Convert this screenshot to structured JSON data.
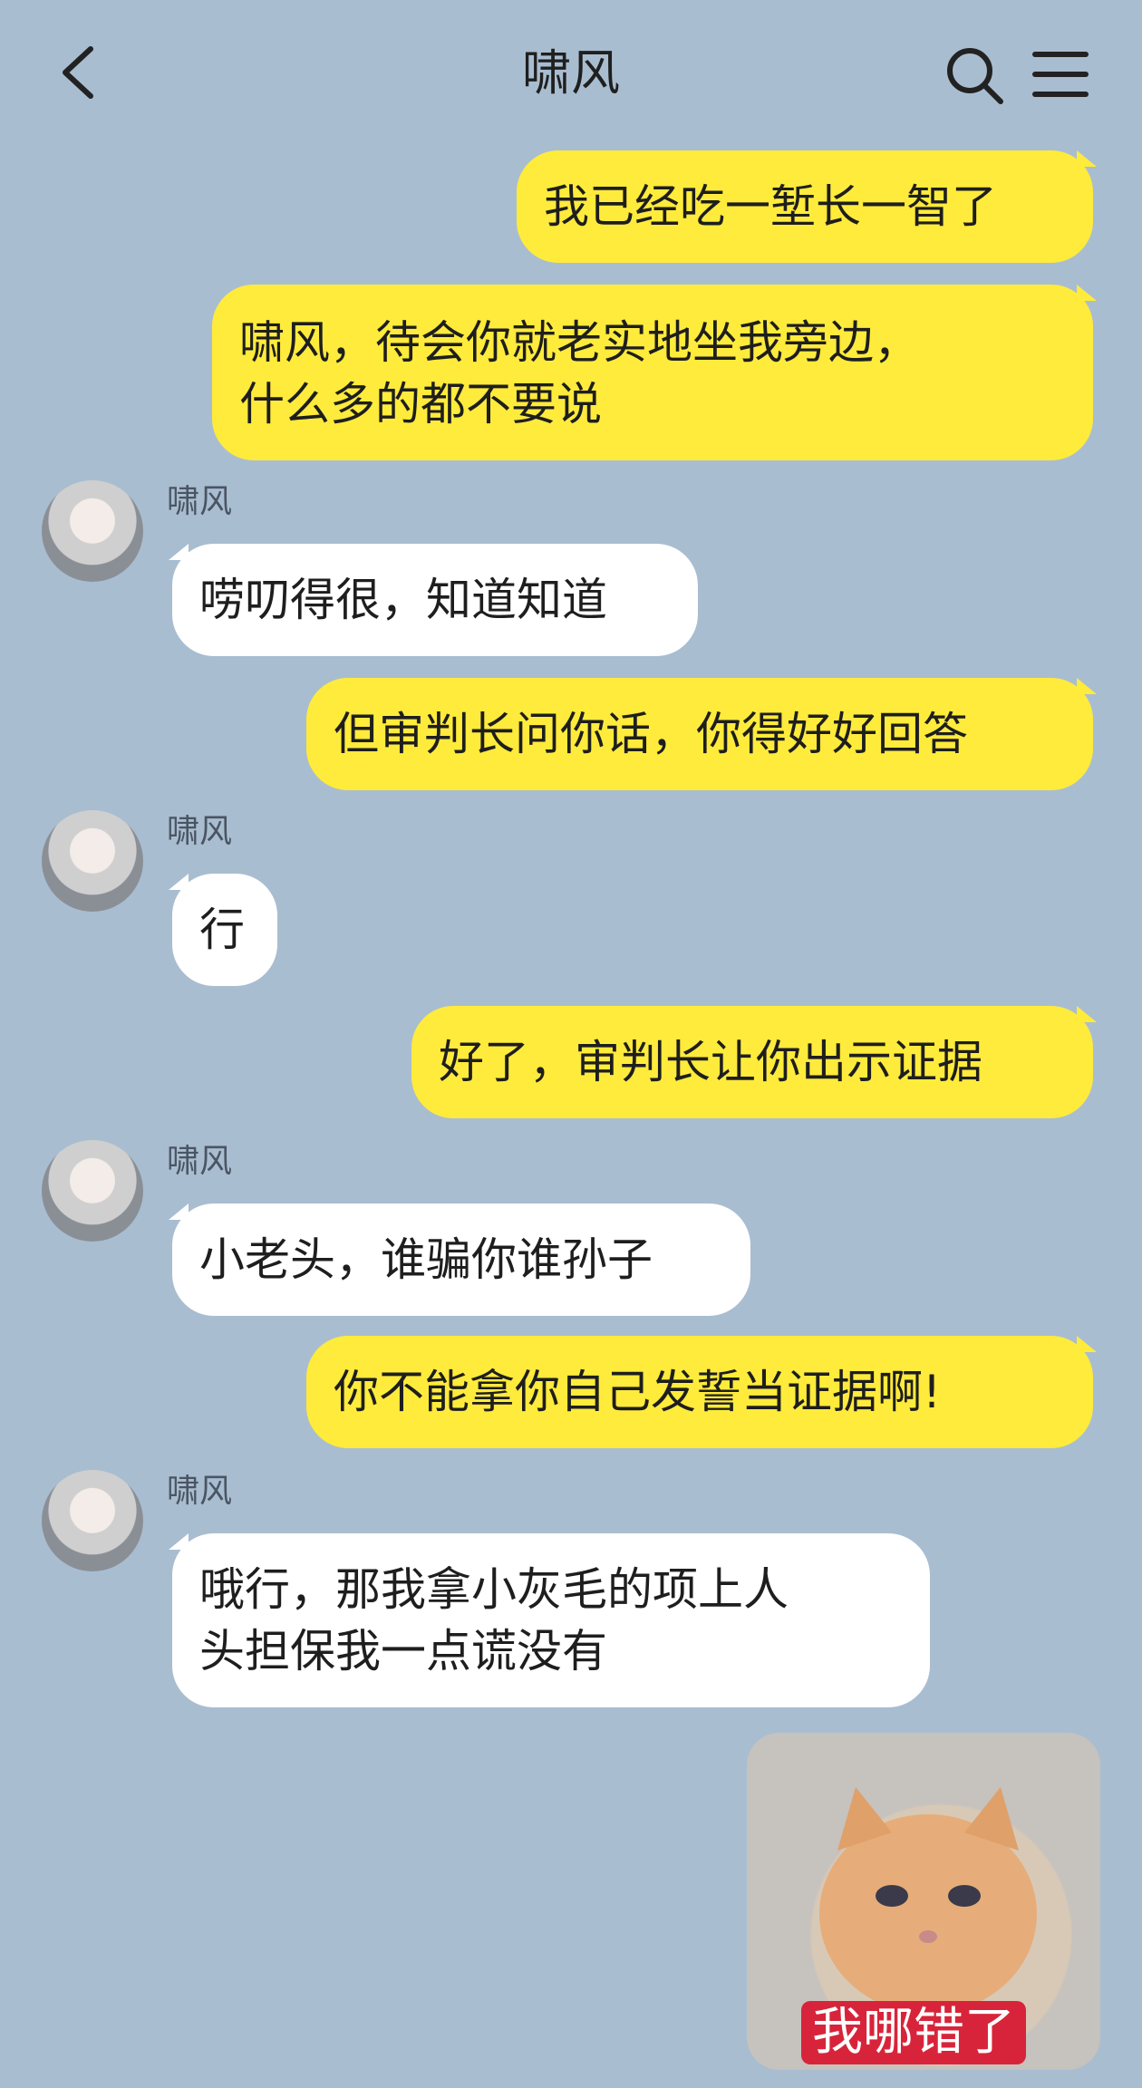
{
  "header": {
    "title": "啸风"
  },
  "icons": {
    "back": "chevron-left-icon",
    "search": "search-icon",
    "menu": "hamburger-menu-icon"
  },
  "colors": {
    "background": "#a9bdd1",
    "my_bubble": "#ffeb3b",
    "their_bubble": "#ffffff",
    "sticker_caption_bg": "#d8243a"
  },
  "messages": [
    {
      "from": "me",
      "text": "我已经吃一堑长一智了"
    },
    {
      "from": "me",
      "text": "啸风，待会你就老实地坐我旁边，\n什么多的都不要说"
    },
    {
      "from": "other",
      "sender": "啸风",
      "text": "唠叨得很，知道知道"
    },
    {
      "from": "me",
      "text": "但审判长问你话，你得好好回答"
    },
    {
      "from": "other",
      "sender": "啸风",
      "text": "行"
    },
    {
      "from": "me",
      "text": "好了，审判长让你出示证据"
    },
    {
      "from": "other",
      "sender": "啸风",
      "text": "小老头，谁骗你谁孙子"
    },
    {
      "from": "me",
      "text": "你不能拿你自己发誓当证据啊!"
    },
    {
      "from": "other",
      "sender": "啸风",
      "text": "哦行，那我拿小灰毛的项上人\n头担保我一点谎没有"
    },
    {
      "from": "me",
      "type": "sticker",
      "caption": "我哪错了"
    }
  ]
}
